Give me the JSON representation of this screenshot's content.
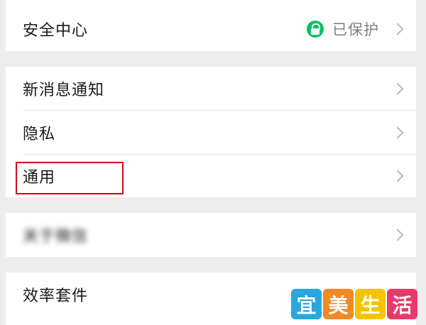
{
  "security": {
    "label": "安全中心",
    "status_text": "已保护",
    "status_icon": "lock-icon",
    "status_color": "#07c160"
  },
  "group2": {
    "items": [
      {
        "label": "新消息通知"
      },
      {
        "label": "隐私"
      },
      {
        "label": "通用"
      }
    ]
  },
  "group3": {
    "items": [
      {
        "label": "关于微信"
      }
    ]
  },
  "group4": {
    "items": [
      {
        "label": "效率套件"
      }
    ]
  },
  "watermark": {
    "chars": [
      "宜",
      "美",
      "生",
      "活"
    ],
    "colors": [
      "#2aa6de",
      "#f08a24",
      "#f5c400",
      "#e83a6a"
    ]
  },
  "colors": {
    "highlight_border": "#d0021b",
    "background": "#ededed"
  }
}
